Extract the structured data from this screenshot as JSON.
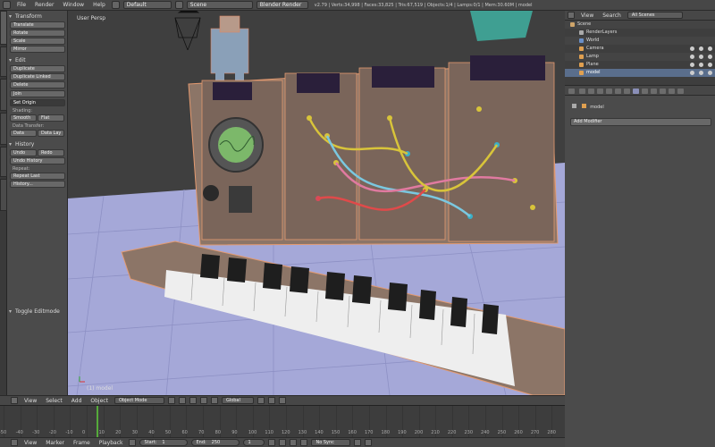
{
  "topbar": {
    "menus": [
      "File",
      "Render",
      "Window",
      "Help"
    ],
    "screen_layout": "Default",
    "scene": "Scene",
    "render_engine": "Blender Render",
    "stats": "v2.79 | Verts:34,998 | Faces:33,825 | Tris:67,519 | Objects:1/4 | Lamps:0/1 | Mem:30.60M | model"
  },
  "toolshelf": {
    "transform": {
      "title": "Transform",
      "buttons": [
        "Translate",
        "Rotate",
        "Scale",
        "Mirror"
      ]
    },
    "edit": {
      "title": "Edit",
      "buttons": [
        "Duplicate",
        "Duplicate Linked",
        "Delete",
        "Join"
      ],
      "set_origin": "Set Origin",
      "shading_label": "Shading:",
      "shading_smooth": "Smooth",
      "shading_flat": "Flat",
      "data_transfer_label": "Data Transfer:",
      "data_btn": "Data",
      "data_lay_btn": "Data Lay"
    },
    "history": {
      "title": "History",
      "undo": "Undo",
      "redo": "Redo",
      "undo_history": "Undo History",
      "repeat_last_label": "Repeat:",
      "repeat_last": "Repeat Last",
      "history_btn": "History..."
    },
    "toggle_editmode": "Toggle Editmode"
  },
  "viewport": {
    "view_label": "User Persp",
    "object_label": "(1) model",
    "module_displays": [
      "100%",
      "160 R",
      "100-0",
      "100-M"
    ]
  },
  "view_header": {
    "menus": [
      "View",
      "Select",
      "Add",
      "Object"
    ],
    "mode": "Object Mode",
    "orientation": "Global"
  },
  "timeline": {
    "ticks": [
      "-50",
      "-40",
      "-30",
      "-20",
      "-10",
      "0",
      "10",
      "20",
      "30",
      "40",
      "50",
      "60",
      "70",
      "80",
      "90",
      "100",
      "110",
      "120",
      "130",
      "140",
      "150",
      "160",
      "170",
      "180",
      "190",
      "200",
      "210",
      "220",
      "230",
      "240",
      "250",
      "260",
      "270",
      "280"
    ],
    "menus": [
      "View",
      "Marker",
      "Frame",
      "Playback"
    ],
    "start_label": "Start:",
    "start_value": "1",
    "end_label": "End:",
    "end_value": "250",
    "current_frame": "1",
    "sync": "No Sync"
  },
  "outliner": {
    "header_menus": [
      "View",
      "Search"
    ],
    "filter": "All Scenes",
    "rows": [
      {
        "label": "Scene",
        "indent": 0
      },
      {
        "label": "RenderLayers",
        "indent": 1
      },
      {
        "label": "World",
        "indent": 1
      },
      {
        "label": "Camera",
        "indent": 1
      },
      {
        "label": "Lamp",
        "indent": 1
      },
      {
        "label": "Plane",
        "indent": 1
      },
      {
        "label": "model",
        "indent": 1
      }
    ]
  },
  "properties": {
    "object_name": "model",
    "add_modifier": "Add Modifier"
  },
  "colors": {
    "accent_select": "#5a6e8c",
    "panel_bg": "#4b4b4b",
    "timeline_frame": "#55aa3a"
  }
}
